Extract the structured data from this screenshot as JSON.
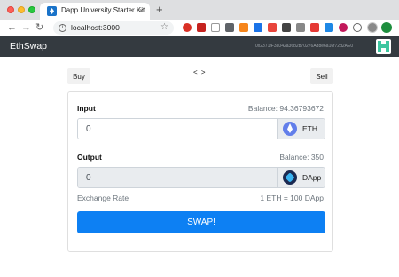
{
  "browser": {
    "tab_title": "Dapp University Starter Kit",
    "tab_close": "×",
    "new_tab": "+",
    "url": "localhost:3000",
    "nav_back": "←",
    "nav_forward": "→",
    "nav_reload": "↻",
    "info": "i",
    "star": "☆"
  },
  "app": {
    "brand": "EthSwap",
    "account": "0x2371fF3a042a36b2b70276Ad8e6a16f72d2AE0"
  },
  "swap": {
    "buy_label": "Buy",
    "sell_label": "Sell",
    "toggle_arrows": "< >",
    "input_label": "Input",
    "input_balance": "Balance: 94.36793672",
    "input_value": "0",
    "input_currency": "ETH",
    "output_label": "Output",
    "output_balance": "Balance: 350",
    "output_value": "0",
    "output_currency": "DApp",
    "rate_label": "Exchange Rate",
    "rate_value": "1 ETH = 100 DApp",
    "swap_label": "SWAP!"
  },
  "colors": {
    "navbar": "#343a40",
    "primary": "#0d80f3",
    "addon_bg": "#e9ecef"
  }
}
